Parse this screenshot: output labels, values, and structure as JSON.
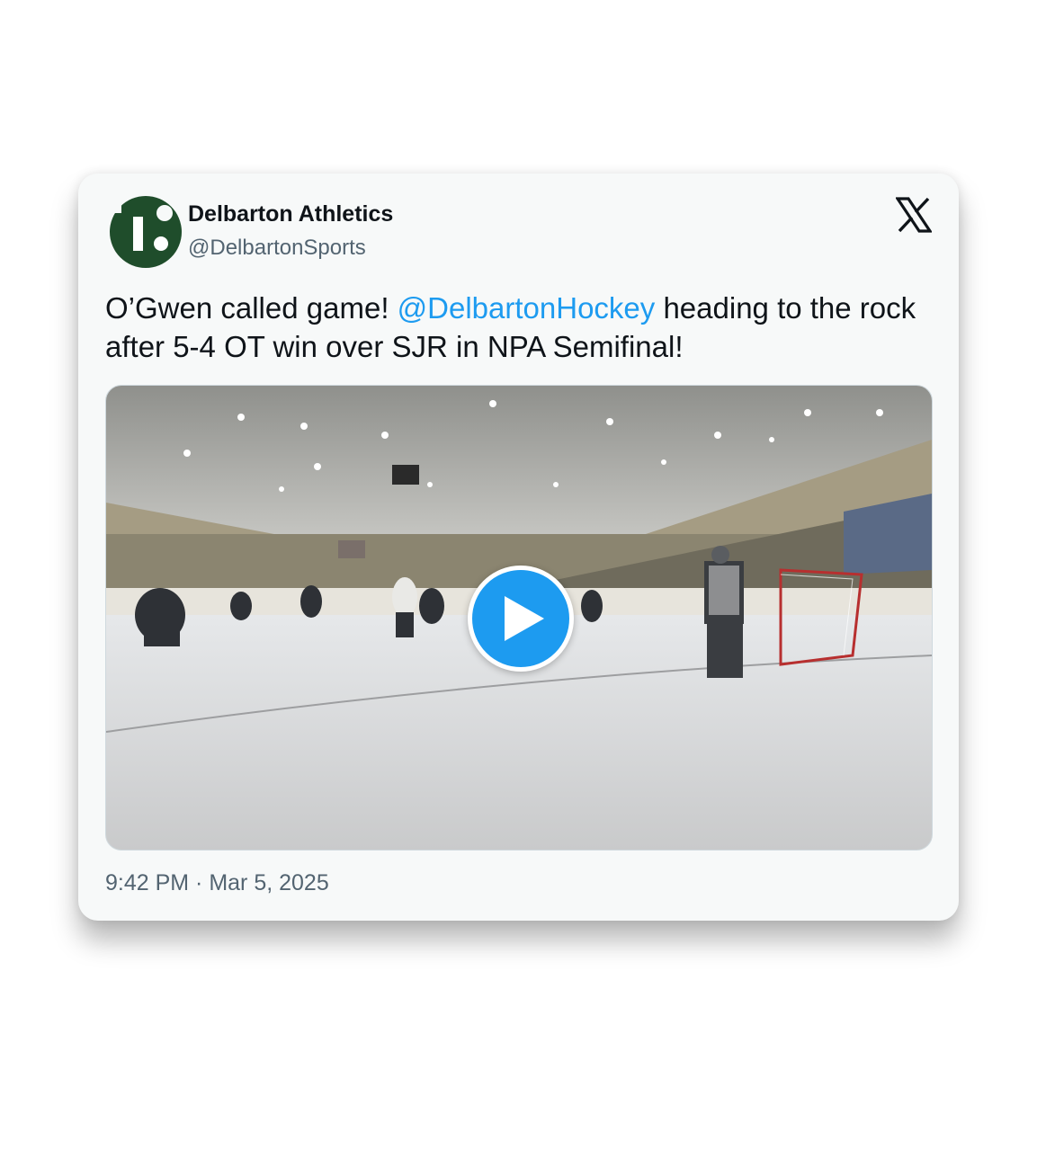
{
  "tweet": {
    "author": {
      "display_name": "Delbarton Athletics",
      "handle": "@DelbartonSports",
      "avatar_icon": "delbarton-d-logo",
      "avatar_color": "#1f4d2b"
    },
    "brand_icon": "x-logo-icon",
    "text_before": "O’Gwen called game!  ",
    "mention": "@DelbartonHockey",
    "text_after": " heading to the rock after 5-4 OT win over SJR in NPA Semifinal!",
    "media": {
      "type": "video",
      "play_icon": "play-icon"
    },
    "timestamp": "9:42 PM · Mar 5, 2025"
  },
  "colors": {
    "link": "#1d9bf0",
    "text": "#0f1419",
    "secondary": "#536471",
    "card_bg": "#f7f9f9"
  }
}
